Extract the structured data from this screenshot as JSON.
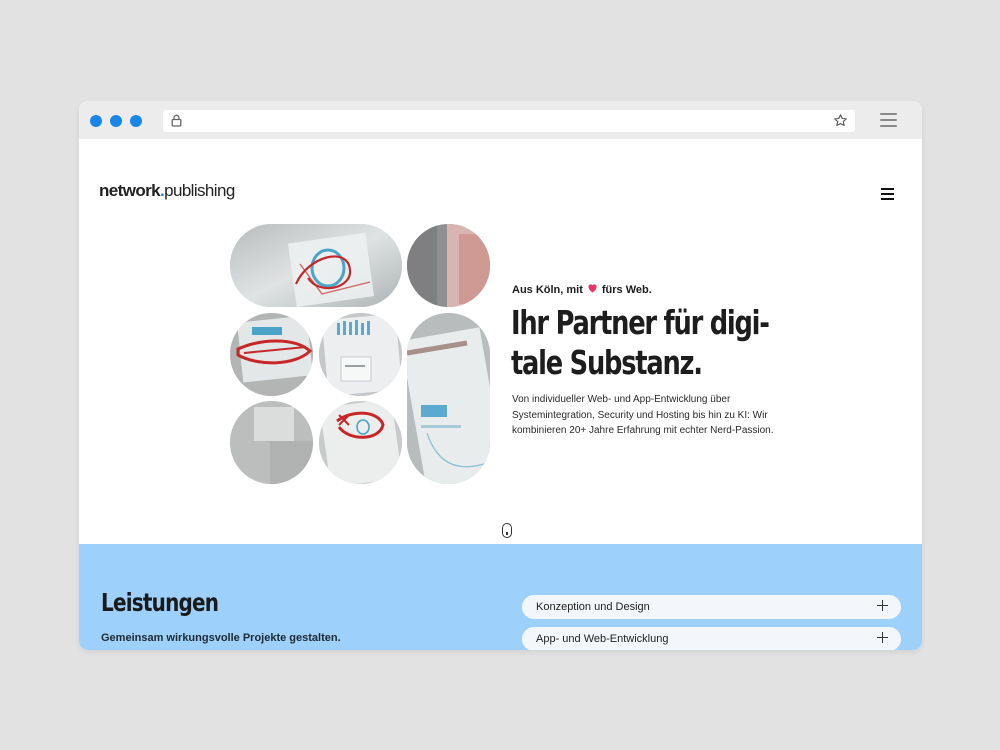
{
  "browser": {
    "window_dots": [
      "traffic-light-1",
      "traffic-light-2",
      "traffic-light-3"
    ],
    "address_value": "",
    "icons": {
      "lock": "lock-icon",
      "bookmark": "star-icon",
      "menu": "hamburger-menu-icon"
    }
  },
  "header": {
    "logo_bold": "network",
    "logo_dot": ".",
    "logo_light": "publishing",
    "menu_icon": "hamburger-menu-icon"
  },
  "hero": {
    "tagline_before": "Aus Köln, mit",
    "tagline_icon": "heart-icon",
    "tagline_after": "fürs Web.",
    "headline_line1": "Ihr Partner für digi-",
    "headline_line2": "tale Substanz.",
    "intro": "Von individueller Web- und App-Entwicklung über Systemintegration, Security und Hosting bis hin zu KI: Wir kombinieren 20+ Jahre Erfahrung mit echter Nerd-Passion.",
    "scroll_icon": "mouse-scroll-icon"
  },
  "services": {
    "title": "Leistungen",
    "subtitle": "Gemeinsam wirkungsvolle Projekte gestalten.",
    "items": [
      {
        "label": "Konzeption und Design",
        "icon": "plus-icon"
      },
      {
        "label": "App- und Web-Entwicklung",
        "icon": "plus-icon"
      }
    ]
  },
  "colors": {
    "accent_blue": "#1a86e8",
    "services_bg": "#9dd1fb",
    "heart": "#e8356a"
  }
}
